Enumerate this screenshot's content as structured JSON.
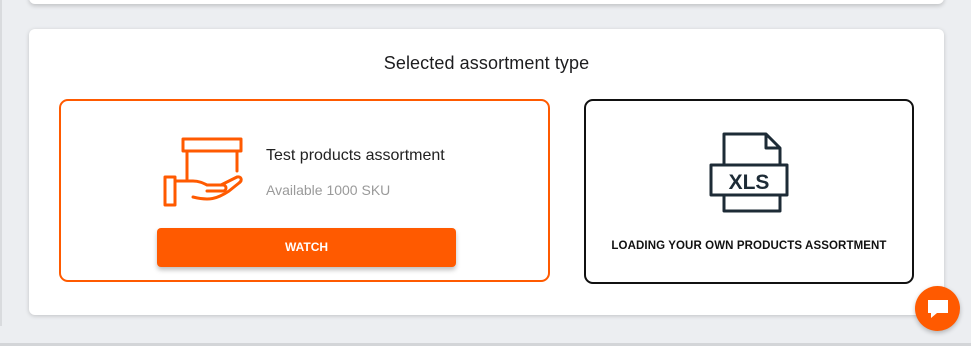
{
  "selection": {
    "title": "Selected assortment type",
    "test_option": {
      "title": "Test products assortment",
      "subtitle": "Available 1000 SKU",
      "button_label": "WATCH",
      "icon": "box-in-hand-icon"
    },
    "own_option": {
      "label": "LOADING YOUR OWN PRODUCTS ASSORTMENT",
      "icon": "xls-file-icon",
      "icon_text": "XLS"
    }
  },
  "chat": {
    "icon": "chat-bubble-icon"
  },
  "colors": {
    "accent": "#ff5a00",
    "dark": "#1d2b36",
    "muted_text": "#9a9a9a"
  }
}
